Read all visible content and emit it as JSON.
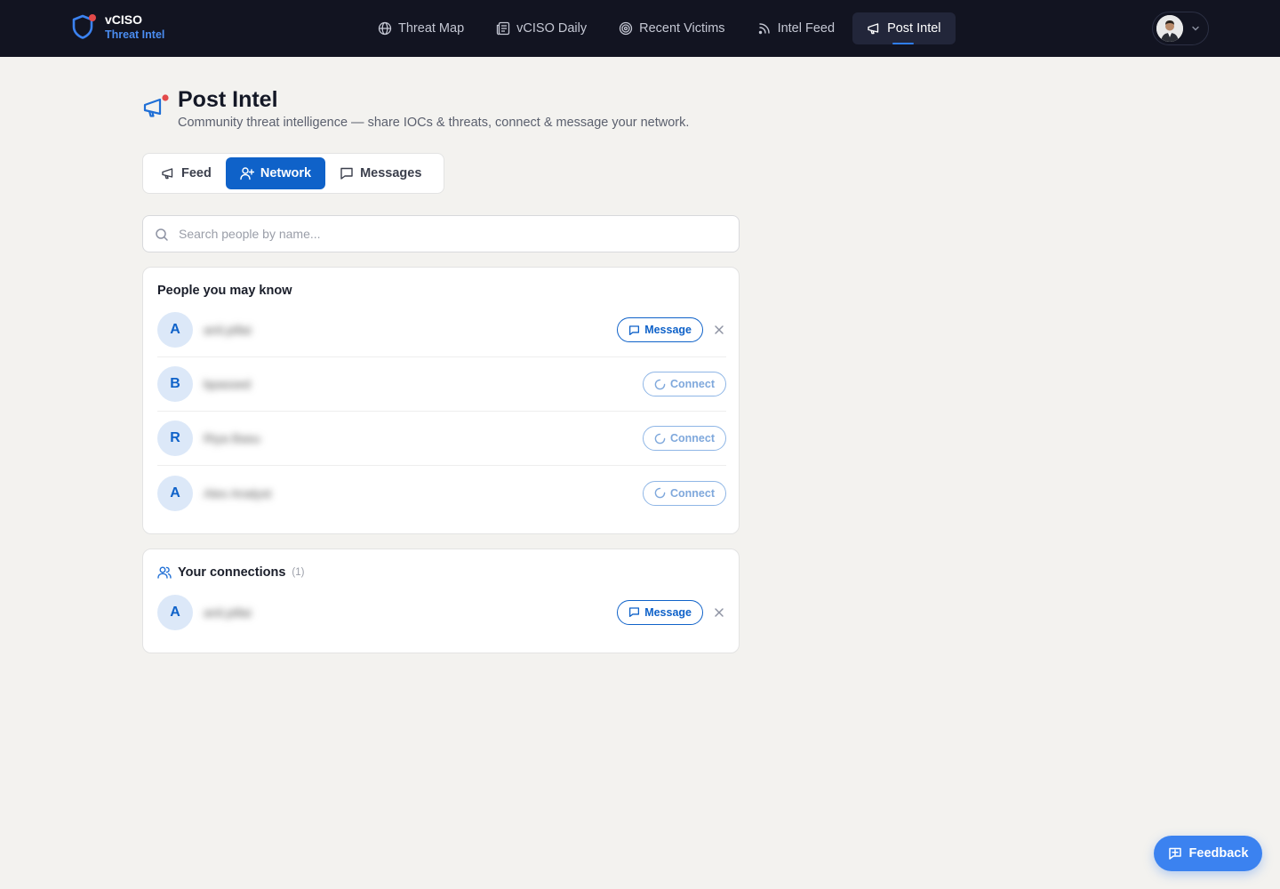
{
  "brand": {
    "title": "vCISO",
    "subtitle": "Threat Intel"
  },
  "nav": [
    {
      "label": "Threat Map",
      "icon": "globe-icon"
    },
    {
      "label": "vCISO Daily",
      "icon": "newspaper-icon"
    },
    {
      "label": "Recent Victims",
      "icon": "target-icon"
    },
    {
      "label": "Intel Feed",
      "icon": "rss-icon"
    },
    {
      "label": "Post Intel",
      "icon": "megaphone-icon",
      "active": true
    }
  ],
  "header": {
    "title": "Post Intel",
    "subtitle": "Community threat intelligence — share IOCs & threats, connect & message your network."
  },
  "tabs": [
    {
      "label": "Feed",
      "icon": "megaphone-icon"
    },
    {
      "label": "Network",
      "icon": "user-plus-icon",
      "active": true
    },
    {
      "label": "Messages",
      "icon": "message-icon"
    }
  ],
  "search": {
    "placeholder": "Search people by name..."
  },
  "suggestions": {
    "title": "People you may know",
    "people": [
      {
        "initial": "A",
        "name": "anil.pillai",
        "action": "Message"
      },
      {
        "initial": "B",
        "name": "bpassed",
        "action": "Connect"
      },
      {
        "initial": "R",
        "name": "Riya Basu",
        "action": "Connect"
      },
      {
        "initial": "A",
        "name": "Alex Analyst",
        "action": "Connect"
      }
    ]
  },
  "connections": {
    "title": "Your connections",
    "count": "(1)",
    "people": [
      {
        "initial": "A",
        "name": "anil.pillai",
        "action": "Message"
      }
    ]
  },
  "feedback": {
    "label": "Feedback"
  },
  "colors": {
    "accent": "#0f62c9",
    "topbar": "#121421",
    "background": "#f3f2ef",
    "brand_sub": "#4a8cf0",
    "alert_dot": "#e34a4a"
  }
}
